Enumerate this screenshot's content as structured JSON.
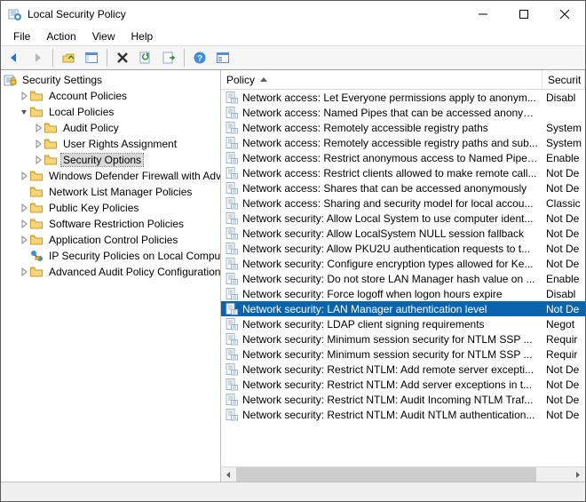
{
  "window": {
    "title": "Local Security Policy"
  },
  "menubar": {
    "items": [
      "File",
      "Action",
      "View",
      "Help"
    ]
  },
  "tree": {
    "root": {
      "label": "Security Settings"
    },
    "items": [
      {
        "indent": 1,
        "expand": "closed",
        "icon": "folder",
        "label": "Account Policies"
      },
      {
        "indent": 1,
        "expand": "open",
        "icon": "folder",
        "label": "Local Policies"
      },
      {
        "indent": 2,
        "expand": "closed",
        "icon": "folder",
        "label": "Audit Policy"
      },
      {
        "indent": 2,
        "expand": "closed",
        "icon": "folder",
        "label": "User Rights Assignment"
      },
      {
        "indent": 2,
        "expand": "closed",
        "icon": "folder",
        "label": "Security Options",
        "selected": true
      },
      {
        "indent": 1,
        "expand": "closed",
        "icon": "folder",
        "label": "Windows Defender Firewall with Adva"
      },
      {
        "indent": 1,
        "expand": "none",
        "icon": "folder",
        "label": "Network List Manager Policies"
      },
      {
        "indent": 1,
        "expand": "closed",
        "icon": "folder",
        "label": "Public Key Policies"
      },
      {
        "indent": 1,
        "expand": "closed",
        "icon": "folder",
        "label": "Software Restriction Policies"
      },
      {
        "indent": 1,
        "expand": "closed",
        "icon": "folder",
        "label": "Application Control Policies"
      },
      {
        "indent": 1,
        "expand": "none",
        "icon": "ipsec",
        "label": "IP Security Policies on Local Compute"
      },
      {
        "indent": 1,
        "expand": "closed",
        "icon": "folder",
        "label": "Advanced Audit Policy Configuration"
      }
    ]
  },
  "list": {
    "header": {
      "policy": "Policy",
      "setting": "Securit"
    },
    "rows": [
      {
        "policy": "Network access: Let Everyone permissions apply to anonym...",
        "setting": "Disabl"
      },
      {
        "policy": "Network access: Named Pipes that can be accessed anonym...",
        "setting": ""
      },
      {
        "policy": "Network access: Remotely accessible registry paths",
        "setting": "System"
      },
      {
        "policy": "Network access: Remotely accessible registry paths and sub...",
        "setting": "System"
      },
      {
        "policy": "Network access: Restrict anonymous access to Named Pipes...",
        "setting": "Enable"
      },
      {
        "policy": "Network access: Restrict clients allowed to make remote call...",
        "setting": "Not De"
      },
      {
        "policy": "Network access: Shares that can be accessed anonymously",
        "setting": "Not De"
      },
      {
        "policy": "Network access: Sharing and security model for local accou...",
        "setting": "Classic"
      },
      {
        "policy": "Network security: Allow Local System to use computer ident...",
        "setting": "Not De"
      },
      {
        "policy": "Network security: Allow LocalSystem NULL session fallback",
        "setting": "Not De"
      },
      {
        "policy": "Network security: Allow PKU2U authentication requests to t...",
        "setting": "Not De"
      },
      {
        "policy": "Network security: Configure encryption types allowed for Ke...",
        "setting": "Not De"
      },
      {
        "policy": "Network security: Do not store LAN Manager hash value on ...",
        "setting": "Enable"
      },
      {
        "policy": "Network security: Force logoff when logon hours expire",
        "setting": "Disabl"
      },
      {
        "policy": "Network security: LAN Manager authentication level",
        "setting": "Not De",
        "selected": true
      },
      {
        "policy": "Network security: LDAP client signing requirements",
        "setting": "Negot"
      },
      {
        "policy": "Network security: Minimum session security for NTLM SSP ...",
        "setting": "Requir"
      },
      {
        "policy": "Network security: Minimum session security for NTLM SSP ...",
        "setting": "Requir"
      },
      {
        "policy": "Network security: Restrict NTLM: Add remote server excepti...",
        "setting": "Not De"
      },
      {
        "policy": "Network security: Restrict NTLM: Add server exceptions in t...",
        "setting": "Not De"
      },
      {
        "policy": "Network security: Restrict NTLM: Audit Incoming NTLM Traf...",
        "setting": "Not De"
      },
      {
        "policy": "Network security: Restrict NTLM: Audit NTLM authentication...",
        "setting": "Not De"
      }
    ]
  }
}
